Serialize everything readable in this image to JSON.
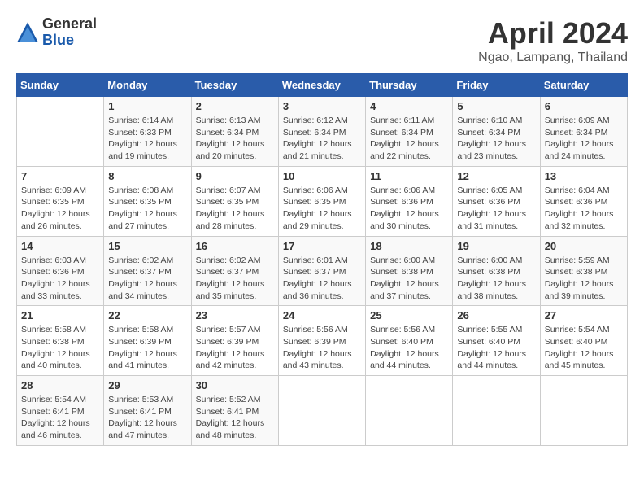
{
  "header": {
    "logo_general": "General",
    "logo_blue": "Blue",
    "month_title": "April 2024",
    "location": "Ngao, Lampang, Thailand"
  },
  "days_of_week": [
    "Sunday",
    "Monday",
    "Tuesday",
    "Wednesday",
    "Thursday",
    "Friday",
    "Saturday"
  ],
  "weeks": [
    [
      {
        "day": "",
        "sunrise": "",
        "sunset": "",
        "daylight": ""
      },
      {
        "day": "1",
        "sunrise": "Sunrise: 6:14 AM",
        "sunset": "Sunset: 6:33 PM",
        "daylight": "Daylight: 12 hours and 19 minutes."
      },
      {
        "day": "2",
        "sunrise": "Sunrise: 6:13 AM",
        "sunset": "Sunset: 6:34 PM",
        "daylight": "Daylight: 12 hours and 20 minutes."
      },
      {
        "day": "3",
        "sunrise": "Sunrise: 6:12 AM",
        "sunset": "Sunset: 6:34 PM",
        "daylight": "Daylight: 12 hours and 21 minutes."
      },
      {
        "day": "4",
        "sunrise": "Sunrise: 6:11 AM",
        "sunset": "Sunset: 6:34 PM",
        "daylight": "Daylight: 12 hours and 22 minutes."
      },
      {
        "day": "5",
        "sunrise": "Sunrise: 6:10 AM",
        "sunset": "Sunset: 6:34 PM",
        "daylight": "Daylight: 12 hours and 23 minutes."
      },
      {
        "day": "6",
        "sunrise": "Sunrise: 6:09 AM",
        "sunset": "Sunset: 6:34 PM",
        "daylight": "Daylight: 12 hours and 24 minutes."
      }
    ],
    [
      {
        "day": "7",
        "sunrise": "Sunrise: 6:09 AM",
        "sunset": "Sunset: 6:35 PM",
        "daylight": "Daylight: 12 hours and 26 minutes."
      },
      {
        "day": "8",
        "sunrise": "Sunrise: 6:08 AM",
        "sunset": "Sunset: 6:35 PM",
        "daylight": "Daylight: 12 hours and 27 minutes."
      },
      {
        "day": "9",
        "sunrise": "Sunrise: 6:07 AM",
        "sunset": "Sunset: 6:35 PM",
        "daylight": "Daylight: 12 hours and 28 minutes."
      },
      {
        "day": "10",
        "sunrise": "Sunrise: 6:06 AM",
        "sunset": "Sunset: 6:35 PM",
        "daylight": "Daylight: 12 hours and 29 minutes."
      },
      {
        "day": "11",
        "sunrise": "Sunrise: 6:06 AM",
        "sunset": "Sunset: 6:36 PM",
        "daylight": "Daylight: 12 hours and 30 minutes."
      },
      {
        "day": "12",
        "sunrise": "Sunrise: 6:05 AM",
        "sunset": "Sunset: 6:36 PM",
        "daylight": "Daylight: 12 hours and 31 minutes."
      },
      {
        "day": "13",
        "sunrise": "Sunrise: 6:04 AM",
        "sunset": "Sunset: 6:36 PM",
        "daylight": "Daylight: 12 hours and 32 minutes."
      }
    ],
    [
      {
        "day": "14",
        "sunrise": "Sunrise: 6:03 AM",
        "sunset": "Sunset: 6:36 PM",
        "daylight": "Daylight: 12 hours and 33 minutes."
      },
      {
        "day": "15",
        "sunrise": "Sunrise: 6:02 AM",
        "sunset": "Sunset: 6:37 PM",
        "daylight": "Daylight: 12 hours and 34 minutes."
      },
      {
        "day": "16",
        "sunrise": "Sunrise: 6:02 AM",
        "sunset": "Sunset: 6:37 PM",
        "daylight": "Daylight: 12 hours and 35 minutes."
      },
      {
        "day": "17",
        "sunrise": "Sunrise: 6:01 AM",
        "sunset": "Sunset: 6:37 PM",
        "daylight": "Daylight: 12 hours and 36 minutes."
      },
      {
        "day": "18",
        "sunrise": "Sunrise: 6:00 AM",
        "sunset": "Sunset: 6:38 PM",
        "daylight": "Daylight: 12 hours and 37 minutes."
      },
      {
        "day": "19",
        "sunrise": "Sunrise: 6:00 AM",
        "sunset": "Sunset: 6:38 PM",
        "daylight": "Daylight: 12 hours and 38 minutes."
      },
      {
        "day": "20",
        "sunrise": "Sunrise: 5:59 AM",
        "sunset": "Sunset: 6:38 PM",
        "daylight": "Daylight: 12 hours and 39 minutes."
      }
    ],
    [
      {
        "day": "21",
        "sunrise": "Sunrise: 5:58 AM",
        "sunset": "Sunset: 6:38 PM",
        "daylight": "Daylight: 12 hours and 40 minutes."
      },
      {
        "day": "22",
        "sunrise": "Sunrise: 5:58 AM",
        "sunset": "Sunset: 6:39 PM",
        "daylight": "Daylight: 12 hours and 41 minutes."
      },
      {
        "day": "23",
        "sunrise": "Sunrise: 5:57 AM",
        "sunset": "Sunset: 6:39 PM",
        "daylight": "Daylight: 12 hours and 42 minutes."
      },
      {
        "day": "24",
        "sunrise": "Sunrise: 5:56 AM",
        "sunset": "Sunset: 6:39 PM",
        "daylight": "Daylight: 12 hours and 43 minutes."
      },
      {
        "day": "25",
        "sunrise": "Sunrise: 5:56 AM",
        "sunset": "Sunset: 6:40 PM",
        "daylight": "Daylight: 12 hours and 44 minutes."
      },
      {
        "day": "26",
        "sunrise": "Sunrise: 5:55 AM",
        "sunset": "Sunset: 6:40 PM",
        "daylight": "Daylight: 12 hours and 44 minutes."
      },
      {
        "day": "27",
        "sunrise": "Sunrise: 5:54 AM",
        "sunset": "Sunset: 6:40 PM",
        "daylight": "Daylight: 12 hours and 45 minutes."
      }
    ],
    [
      {
        "day": "28",
        "sunrise": "Sunrise: 5:54 AM",
        "sunset": "Sunset: 6:41 PM",
        "daylight": "Daylight: 12 hours and 46 minutes."
      },
      {
        "day": "29",
        "sunrise": "Sunrise: 5:53 AM",
        "sunset": "Sunset: 6:41 PM",
        "daylight": "Daylight: 12 hours and 47 minutes."
      },
      {
        "day": "30",
        "sunrise": "Sunrise: 5:52 AM",
        "sunset": "Sunset: 6:41 PM",
        "daylight": "Daylight: 12 hours and 48 minutes."
      },
      {
        "day": "",
        "sunrise": "",
        "sunset": "",
        "daylight": ""
      },
      {
        "day": "",
        "sunrise": "",
        "sunset": "",
        "daylight": ""
      },
      {
        "day": "",
        "sunrise": "",
        "sunset": "",
        "daylight": ""
      },
      {
        "day": "",
        "sunrise": "",
        "sunset": "",
        "daylight": ""
      }
    ]
  ]
}
